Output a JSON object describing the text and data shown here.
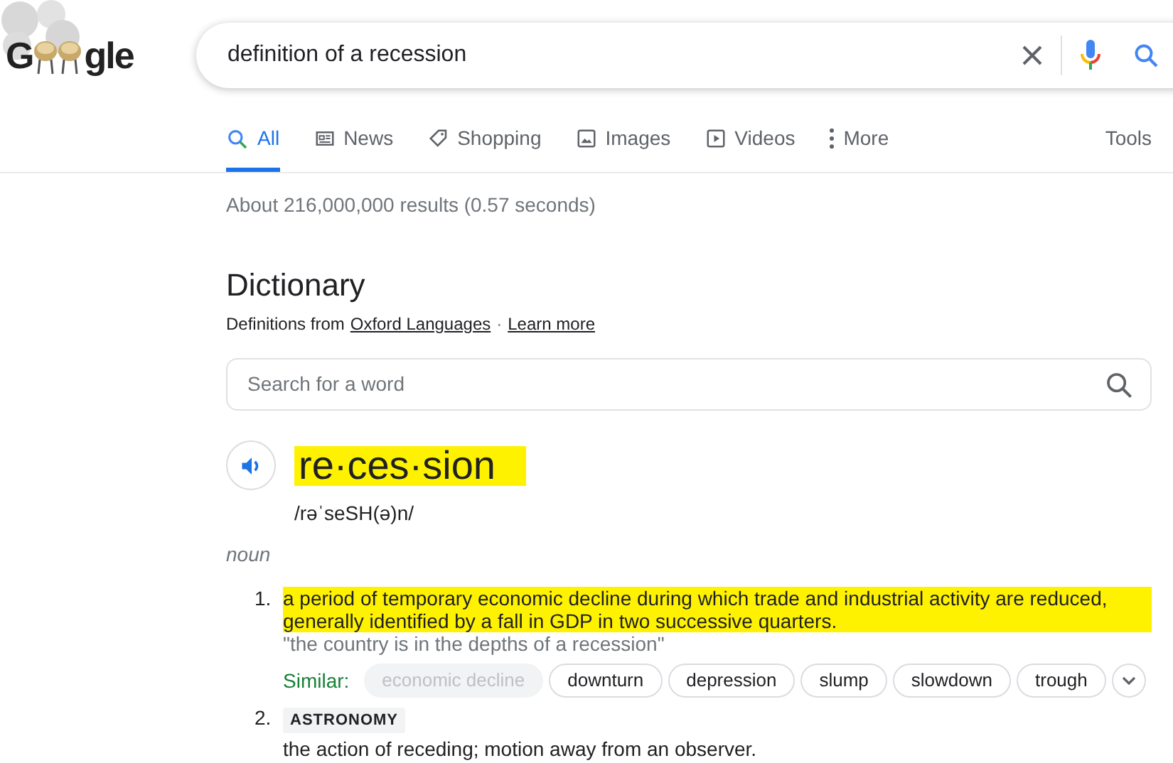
{
  "logo": {
    "parts": [
      "G",
      "gle"
    ]
  },
  "search": {
    "value": "definition of a recession"
  },
  "tabs": [
    {
      "label": "All",
      "kind": "search",
      "selected": true
    },
    {
      "label": "News",
      "kind": "news",
      "selected": false
    },
    {
      "label": "Shopping",
      "kind": "tag",
      "selected": false
    },
    {
      "label": "Images",
      "kind": "image",
      "selected": false
    },
    {
      "label": "Videos",
      "kind": "video",
      "selected": false
    },
    {
      "label": "More",
      "kind": "dots",
      "selected": false
    }
  ],
  "tools": "Tools",
  "result_stats": "About 216,000,000 results (0.57 seconds)",
  "dictionary": {
    "title": "Dictionary",
    "source_prefix": "Definitions from",
    "source_link": "Oxford Languages",
    "separator": "·",
    "learn_more": "Learn more",
    "word_search": {
      "placeholder": "Search for a word"
    },
    "headword": "re·ces·sion",
    "headword_highlighted": true,
    "pronunciation": "/rəˈseSH(ə)n/",
    "part_of_speech": "noun",
    "senses": [
      {
        "number": "1.",
        "definition": "a period of temporary economic decline during which trade and industrial activity are reduced, generally identified by a fall in GDP in two successive quarters.",
        "highlighted": true,
        "example": "\"the country is in the depths of a recession\"",
        "similar_label": "Similar:",
        "similar": [
          {
            "label": "economic decline",
            "disabled": true
          },
          {
            "label": "downturn",
            "disabled": false
          },
          {
            "label": "depression",
            "disabled": false
          },
          {
            "label": "slump",
            "disabled": false
          },
          {
            "label": "slowdown",
            "disabled": false
          },
          {
            "label": "trough",
            "disabled": false
          }
        ]
      },
      {
        "number": "2.",
        "tag": "ASTRONOMY",
        "definition": "the action of receding; motion away from an observer.",
        "highlighted": false
      }
    ]
  }
}
